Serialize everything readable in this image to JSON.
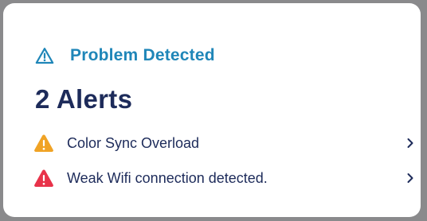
{
  "card": {
    "header": {
      "icon": "warning-outline-icon",
      "title": "Problem Detected",
      "color": "#1f86b8"
    },
    "alert_count_text": "2 Alerts",
    "alerts": [
      {
        "icon": "warning-icon",
        "icon_color": "#f0a325",
        "label": "Color Sync Overload",
        "chevron": "chevron-right-icon"
      },
      {
        "icon": "warning-icon",
        "icon_color": "#e8334a",
        "label": "Weak Wifi connection detected.",
        "chevron": "chevron-right-icon"
      }
    ],
    "text_color": "#1d2b5a"
  }
}
